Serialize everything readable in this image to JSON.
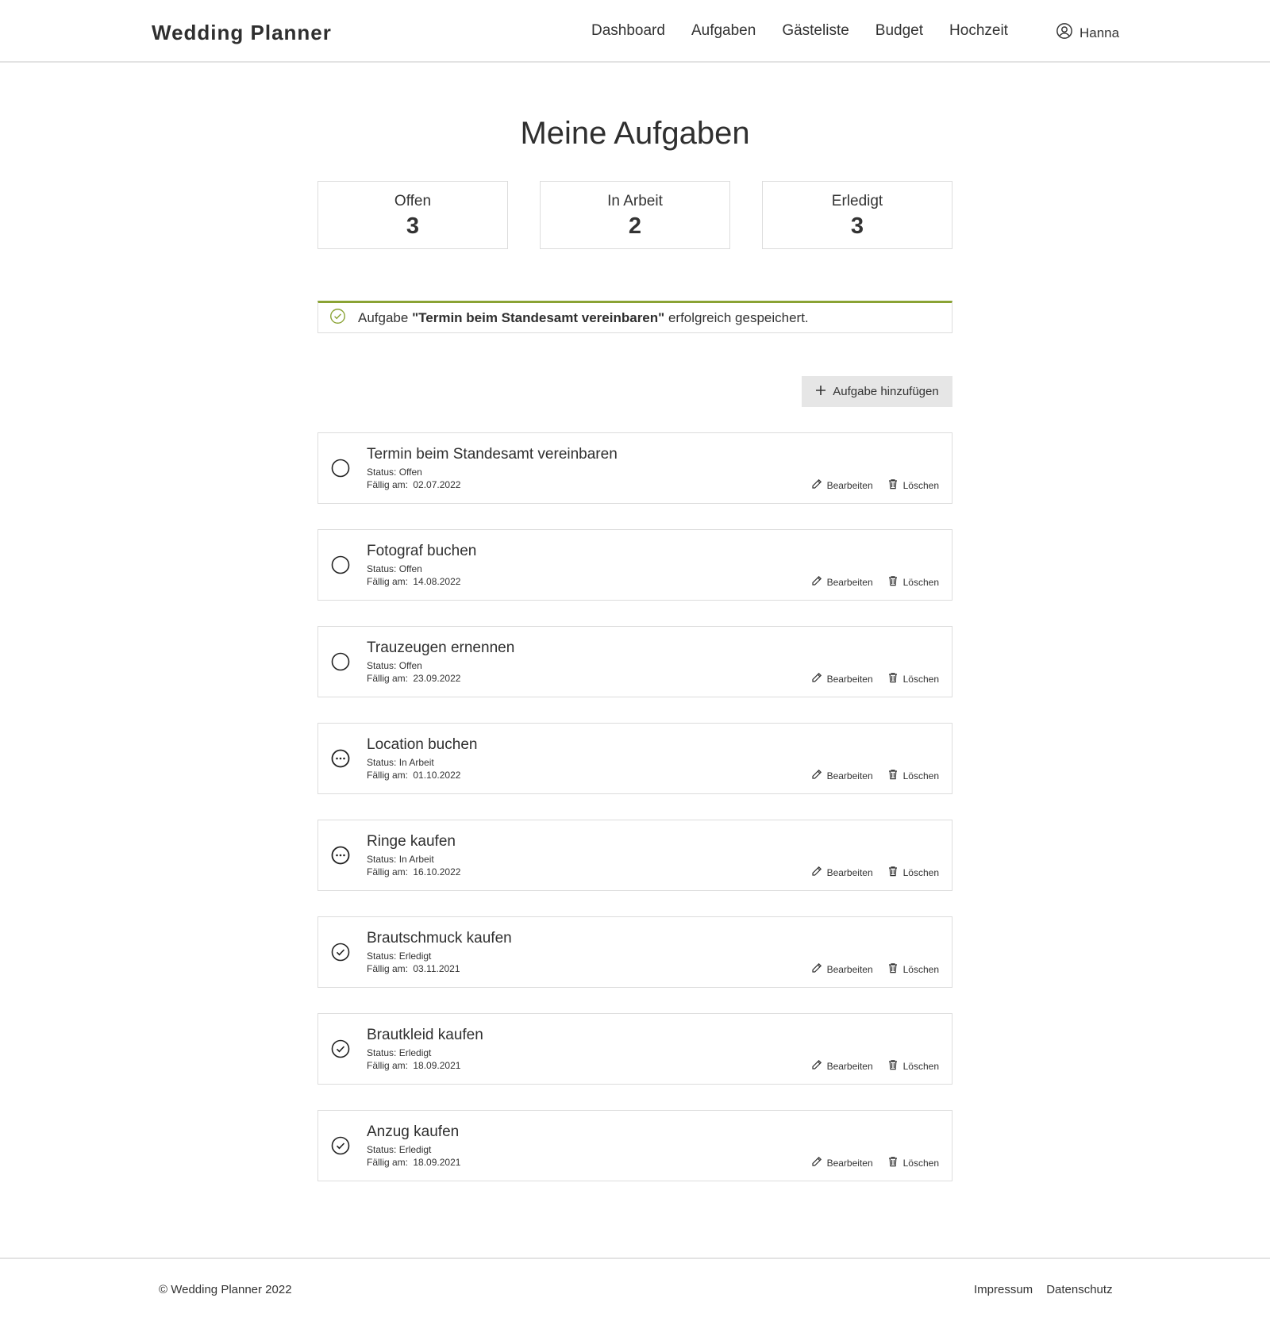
{
  "header": {
    "brand": "Wedding Planner",
    "nav": [
      "Dashboard",
      "Aufgaben",
      "Gästeliste",
      "Budget",
      "Hochzeit"
    ],
    "user_name": "Hanna",
    "user_icon": "user-circle-icon"
  },
  "page_title": "Meine Aufgaben",
  "stats": [
    {
      "label": "Offen",
      "value": "3"
    },
    {
      "label": "In Arbeit",
      "value": "2"
    },
    {
      "label": "Erledigt",
      "value": "3"
    }
  ],
  "alert": {
    "prefix": "Aufgabe",
    "task_name": "\"Termin beim Standesamt vereinbaren\"",
    "suffix": "erfolgreich gespeichert.",
    "icon": "check-circle-icon",
    "accent_color": "#8aa334"
  },
  "add_button": {
    "label": "Aufgabe hinzufügen",
    "icon": "plus-icon"
  },
  "due_label": "Fällig am:",
  "actions": {
    "edit": "Bearbeiten",
    "delete": "Löschen",
    "edit_icon": "pencil-icon",
    "delete_icon": "trash-icon"
  },
  "tasks": [
    {
      "title": "Termin beim Standesamt vereinbaren",
      "status": "Status: Offen",
      "due": "02.07.2022",
      "state": "open"
    },
    {
      "title": "Fotograf buchen",
      "status": "Status: Offen",
      "due": "14.08.2022",
      "state": "open"
    },
    {
      "title": "Trauzeugen ernennen",
      "status": "Status: Offen",
      "due": "23.09.2022",
      "state": "open"
    },
    {
      "title": "Location buchen",
      "status": "Status: In Arbeit",
      "due": "01.10.2022",
      "state": "progress"
    },
    {
      "title": "Ringe kaufen",
      "status": "Status: In Arbeit",
      "due": "16.10.2022",
      "state": "progress"
    },
    {
      "title": "Brautschmuck kaufen",
      "status": "Status: Erledigt",
      "due": "03.11.2021",
      "state": "done"
    },
    {
      "title": "Brautkleid kaufen",
      "status": "Status: Erledigt",
      "due": "18.09.2021",
      "state": "done"
    },
    {
      "title": "Anzug kaufen",
      "status": "Status: Erledigt",
      "due": "18.09.2021",
      "state": "done"
    }
  ],
  "footer": {
    "copyright": "© Wedding Planner 2022",
    "links": [
      "Impressum",
      "Datenschutz"
    ]
  }
}
